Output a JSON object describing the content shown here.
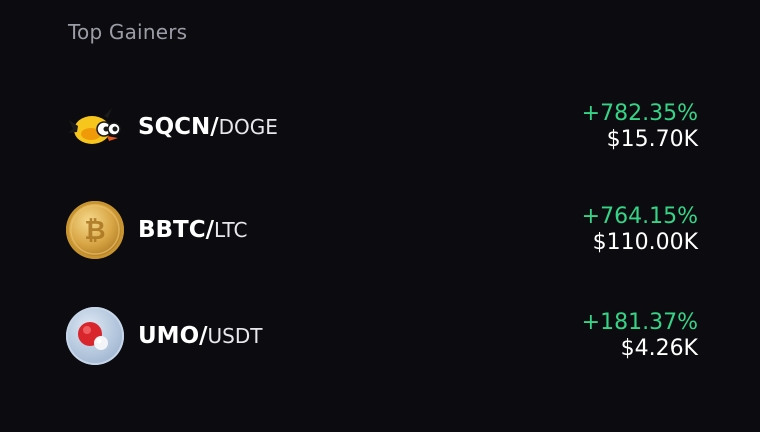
{
  "widget": {
    "title": "Top Gainers"
  },
  "rows": [
    {
      "base": "SQCN",
      "slash": "/",
      "quote": "DOGE",
      "change": "+782.35%",
      "price": "$15.70K",
      "icon": "bird-coin-icon"
    },
    {
      "base": "BBTC",
      "slash": "/",
      "quote": "LTC",
      "change": "+764.15%",
      "price": "$110.00K",
      "icon": "bitcoin-coin-icon"
    },
    {
      "base": "UMO",
      "slash": "/",
      "quote": "USDT",
      "change": "+181.37%",
      "price": "$4.26K",
      "icon": "molecule-coin-icon"
    }
  ],
  "colors": {
    "background": "#0c0c10",
    "positive": "#35d487",
    "title": "#9c9ca6"
  }
}
